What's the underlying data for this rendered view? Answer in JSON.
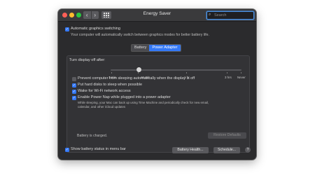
{
  "window": {
    "title": "Energy Saver",
    "nav_back": "‹",
    "nav_forward": "›",
    "search": {
      "placeholder": "Search"
    }
  },
  "auto_graphics": {
    "label": "Automatic graphics switching",
    "description": "Your computer will automatically switch between graphics modes for better battery life.",
    "checked": true
  },
  "tabs": [
    {
      "label": "Battery",
      "active": false
    },
    {
      "label": "Power Adapter",
      "active": true
    }
  ],
  "display_sleep": {
    "label": "Turn display off after:",
    "ticks": [
      "1 min",
      "15 min",
      "1 hr",
      "3 hrs",
      "Never"
    ],
    "value_label": "15 min"
  },
  "options": [
    {
      "label": "Prevent computer from sleeping automatically when the display is off",
      "checked": false
    },
    {
      "label": "Put hard disks to sleep when possible",
      "checked": true
    },
    {
      "label": "Wake for Wi-Fi network access",
      "checked": true
    },
    {
      "label": "Enable Power Nap while plugged into a power adapter",
      "checked": true
    }
  ],
  "power_nap_description_line1": "While sleeping, your Mac can back up using Time Machine and periodically check for new email,",
  "power_nap_description_line2": "calendar, and other iCloud updates",
  "battery_status": "Battery is charged.",
  "buttons": {
    "restore_defaults": "Restore Defaults",
    "battery_health": "Battery Health...",
    "schedule": "Schedule...",
    "help": "?"
  },
  "show_battery_status": {
    "label": "Show battery status in menu bar",
    "checked": true
  },
  "colors": {
    "accent": "#3478f6",
    "window_bg": "#2b2b2d"
  }
}
